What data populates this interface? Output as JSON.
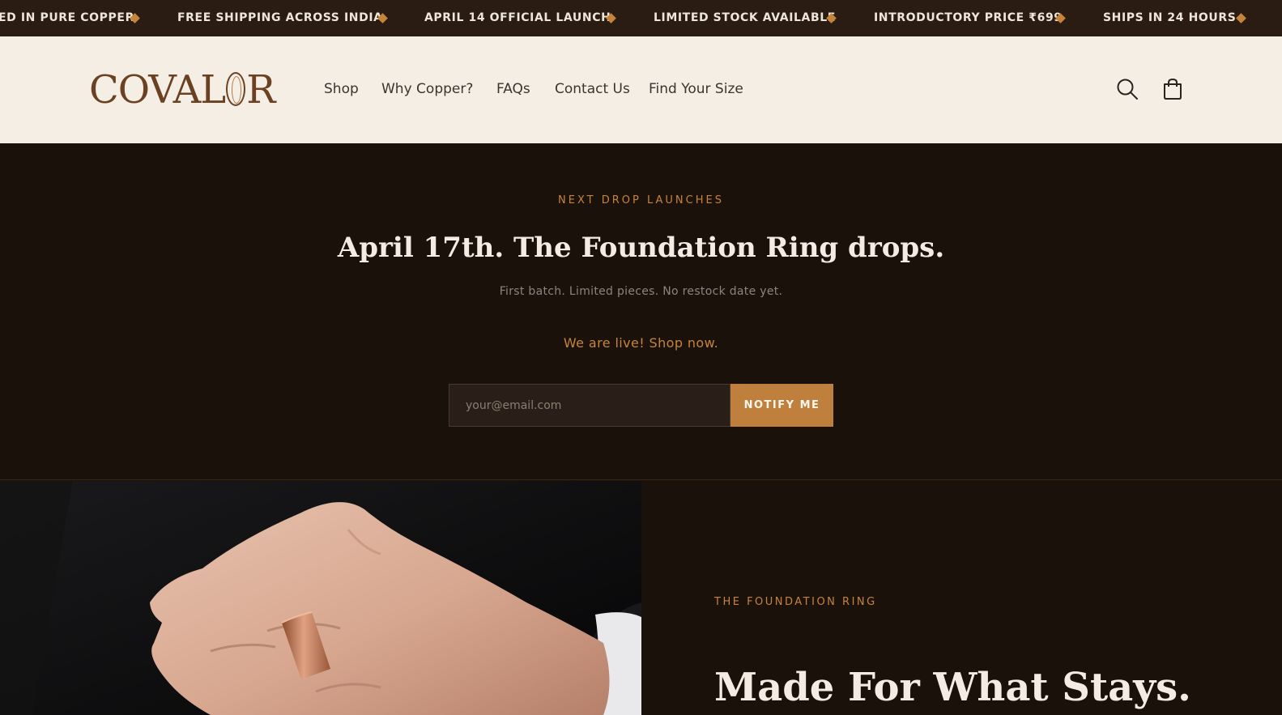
{
  "announcement_bar": {
    "items": [
      "ED IN PURE COPPER",
      "FREE SHIPPING ACROSS INDIA",
      "APRIL 14 OFFICIAL LAUNCH",
      "LIMITED STOCK AVAILABLE",
      "INTRODUCTORY PRICE ₹699",
      "SHIPS IN 24 HOURS"
    ],
    "separator_icon": "diamond-icon",
    "separator_color": "#c6843a"
  },
  "header": {
    "logo_text_left": "COVAL",
    "logo_text_right": "R",
    "nav": [
      "Shop",
      "Why Copper?",
      "FAQs",
      "Contact Us",
      "Find Your Size"
    ],
    "icons": [
      "search-icon",
      "cart-icon"
    ]
  },
  "drop": {
    "eyebrow": "NEXT DROP LAUNCHES",
    "title": "April 17th. The Foundation Ring drops.",
    "subtitle": "First batch. Limited pieces. No restock date yet.",
    "live_link": "We are live! Shop now.",
    "email_placeholder": "your@email.com",
    "notify_label": "NOTIFY ME"
  },
  "feature": {
    "eyebrow": "THE FOUNDATION RING",
    "title": "Made For What Stays."
  },
  "colors": {
    "accent": "#c6843a",
    "background_dark": "#1b110b",
    "header_bg": "#f5eee5",
    "brand_brown": "#6b4122"
  }
}
